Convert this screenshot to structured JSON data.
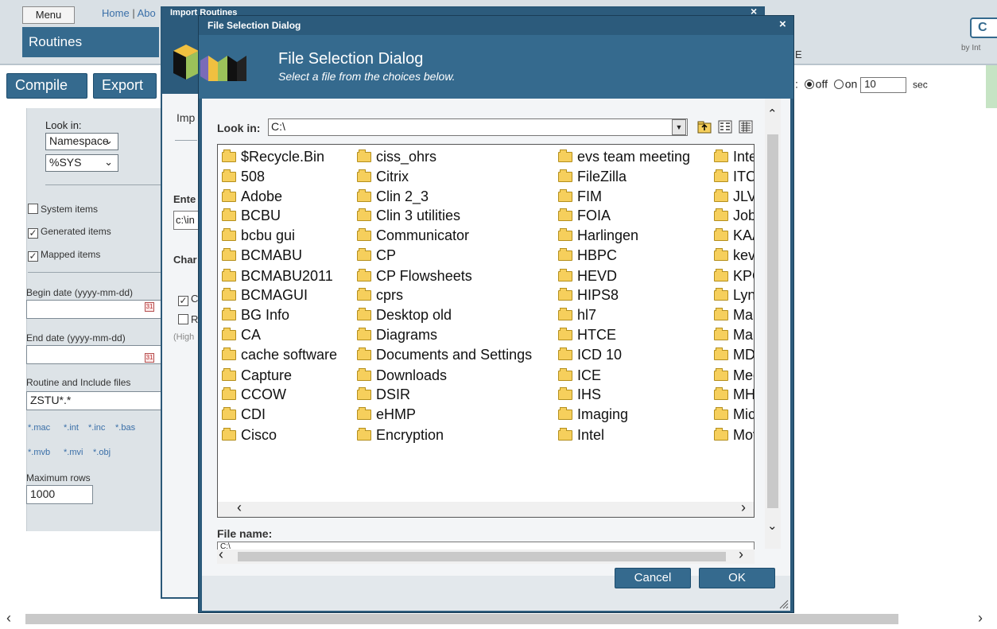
{
  "header": {
    "menu_label": "Menu",
    "home_link": "Home",
    "about_link": "Abo",
    "separator": "|",
    "page_tab": "Routines",
    "top_right_button": "C",
    "top_right_sub": "by Int",
    "column_letter": "E"
  },
  "actions": {
    "compile": "Compile",
    "export": "Export",
    "refresh_off": "off",
    "refresh_on": "on",
    "refresh_value": "10",
    "refresh_unit": "sec",
    "refresh_colon": ":"
  },
  "left_panel": {
    "look_in_label": "Look in:",
    "look_in_type": "Namespace",
    "namespace": "%SYS",
    "system_items": "System items",
    "generated_items": "Generated items",
    "mapped_items": "Mapped items",
    "begin_date_label": "Begin date (yyyy-mm-dd)",
    "end_date_label": "End date (yyyy-mm-dd)",
    "routine_files_label": "Routine and Include files",
    "routine_pattern": "ZSTU*.*",
    "ext_links": [
      "*.mac",
      "*.int",
      "*.inc",
      "*.bas",
      "*.mvb",
      "*.mvi",
      "*.obj"
    ],
    "max_rows_label": "Maximum rows",
    "max_rows": "1000"
  },
  "import_dialog": {
    "title": "Import Routines",
    "imp_label": "Imp",
    "enter_label": "Ente",
    "path_value": "c:\\in",
    "char_label": "Char",
    "opt_c": "C",
    "opt_r": "R",
    "high_label": "(High"
  },
  "file_dialog": {
    "titlebar": "File Selection Dialog",
    "heading": "File Selection Dialog",
    "subheading": "Select a file from the choices below.",
    "look_in_label": "Look in:",
    "look_in_value": "C:\\",
    "file_name_label": "File name:",
    "file_name_value": "C:\\",
    "cancel": "Cancel",
    "ok": "OK",
    "columns": [
      [
        "$Recycle.Bin",
        "508",
        "Adobe",
        "BCBU",
        "bcbu gui",
        "BCMABU",
        "BCMABU2011",
        "BCMAGUI",
        "BG Info",
        "CA",
        "cache software",
        "Capture",
        "CCOW",
        "CDI",
        "Cisco"
      ],
      [
        "ciss_ohrs",
        "Citrix",
        "Clin 2_3",
        "Clin 3 utilities",
        "Communicator",
        "CP",
        "CP Flowsheets",
        "cprs",
        "Desktop old",
        "Diagrams",
        "Documents and Settings",
        "Downloads",
        "DSIR",
        "eHMP",
        "Encryption"
      ],
      [
        "evs team meeting",
        "FileZilla",
        "FIM",
        "FOIA",
        "Harlingen",
        "HBPC",
        "HEVD",
        "HIPS8",
        "hl7",
        "HTCE",
        "ICD 10",
        "ICE",
        "IHS",
        "Imaging",
        "Intel"
      ],
      [
        "Inter",
        "ITC",
        "JLV",
        "Job",
        "KAA",
        "kevi",
        "KPC",
        "Lync",
        "Man",
        "Mari",
        "MDV",
        "Med",
        "MHV",
        "Micr",
        "Mov"
      ]
    ]
  },
  "colors": {
    "dialog_blue": "#356a8e",
    "title_blue": "#2c5b7c",
    "folder_yellow": "#f6cf5c"
  }
}
